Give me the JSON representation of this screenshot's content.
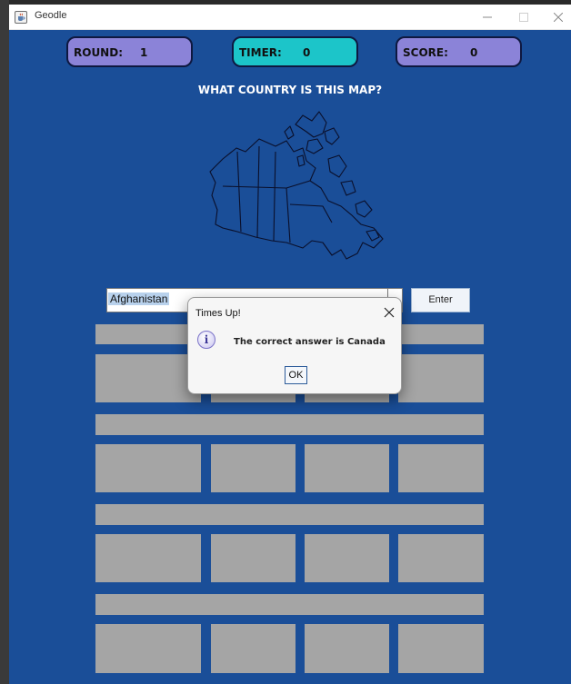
{
  "window": {
    "title": "Geodle",
    "app_icon": "java-coffee-icon"
  },
  "header": {
    "round_label": "ROUND:",
    "round_value": "1",
    "timer_label": "TIMER:",
    "timer_value": "0",
    "score_label": "SCORE:",
    "score_value": "0"
  },
  "question": "WHAT COUNTRY IS THIS MAP?",
  "map": {
    "country_shape": "canada-outline"
  },
  "guess": {
    "value": "Afghanistan",
    "enter_label": "Enter"
  },
  "dialog": {
    "title": "Times Up!",
    "message": "The correct answer is Canada",
    "ok_label": "OK",
    "icon": "info-icon"
  },
  "colors": {
    "background": "#1a4e98",
    "pill_purple": "#8b83d8",
    "pill_cyan": "#1cc5c9",
    "tile": "#a5a5a5"
  }
}
